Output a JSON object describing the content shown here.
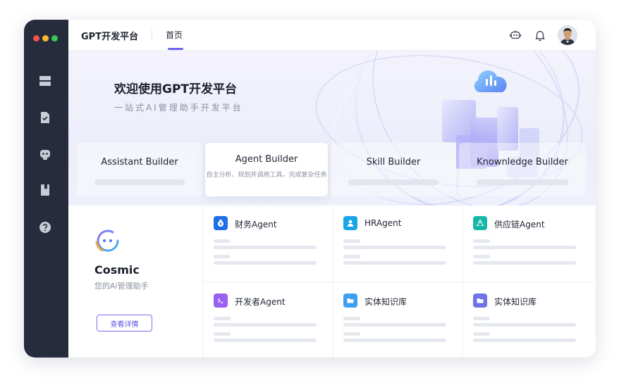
{
  "window": {
    "traffic_lights": [
      "#f2534c",
      "#f6b935",
      "#35c759"
    ]
  },
  "sidebar": {
    "items": [
      {
        "icon": "server-icon"
      },
      {
        "icon": "document-check-icon"
      },
      {
        "icon": "robot-icon"
      },
      {
        "icon": "bookmark-book-icon"
      },
      {
        "icon": "help-icon"
      }
    ]
  },
  "header": {
    "app_title": "GPT开发平台",
    "nav_tab": "首页",
    "icons": [
      "robot-icon",
      "bell-icon"
    ],
    "accent_color": "#6d63f2"
  },
  "hero": {
    "title": "欢迎使用GPT开发平台",
    "subtitle": "一站式AI管理助手开发平台"
  },
  "builders": [
    {
      "label": "Assistant Builder",
      "active": false
    },
    {
      "label": "Agent Builder",
      "active": true,
      "description": "自主分析、规划并调用工具，完成复杂任务"
    },
    {
      "label": "Skill Builder",
      "active": false
    },
    {
      "label": "Knownledge Builder",
      "active": false
    }
  ],
  "cosmic": {
    "name": "Cosmic",
    "subtitle": "您的Ai管理助手",
    "button_label": "查看详情"
  },
  "agents": [
    {
      "name": "财务Agent",
      "icon": "money-bag-icon",
      "color": "#1f6fe5"
    },
    {
      "name": "HRAgent",
      "icon": "person-icon",
      "color": "#19a6e6"
    },
    {
      "name": "供应链Agent",
      "icon": "recycle-icon",
      "color": "#15b8a8"
    },
    {
      "name": "开发者Agent",
      "icon": "terminal-icon",
      "color": "#9a61f0"
    },
    {
      "name": "实体知识库",
      "icon": "folder-icon",
      "color": "#3d9ff0"
    },
    {
      "name": "实体知识库",
      "icon": "folder-icon",
      "color": "#6f73e6"
    }
  ]
}
